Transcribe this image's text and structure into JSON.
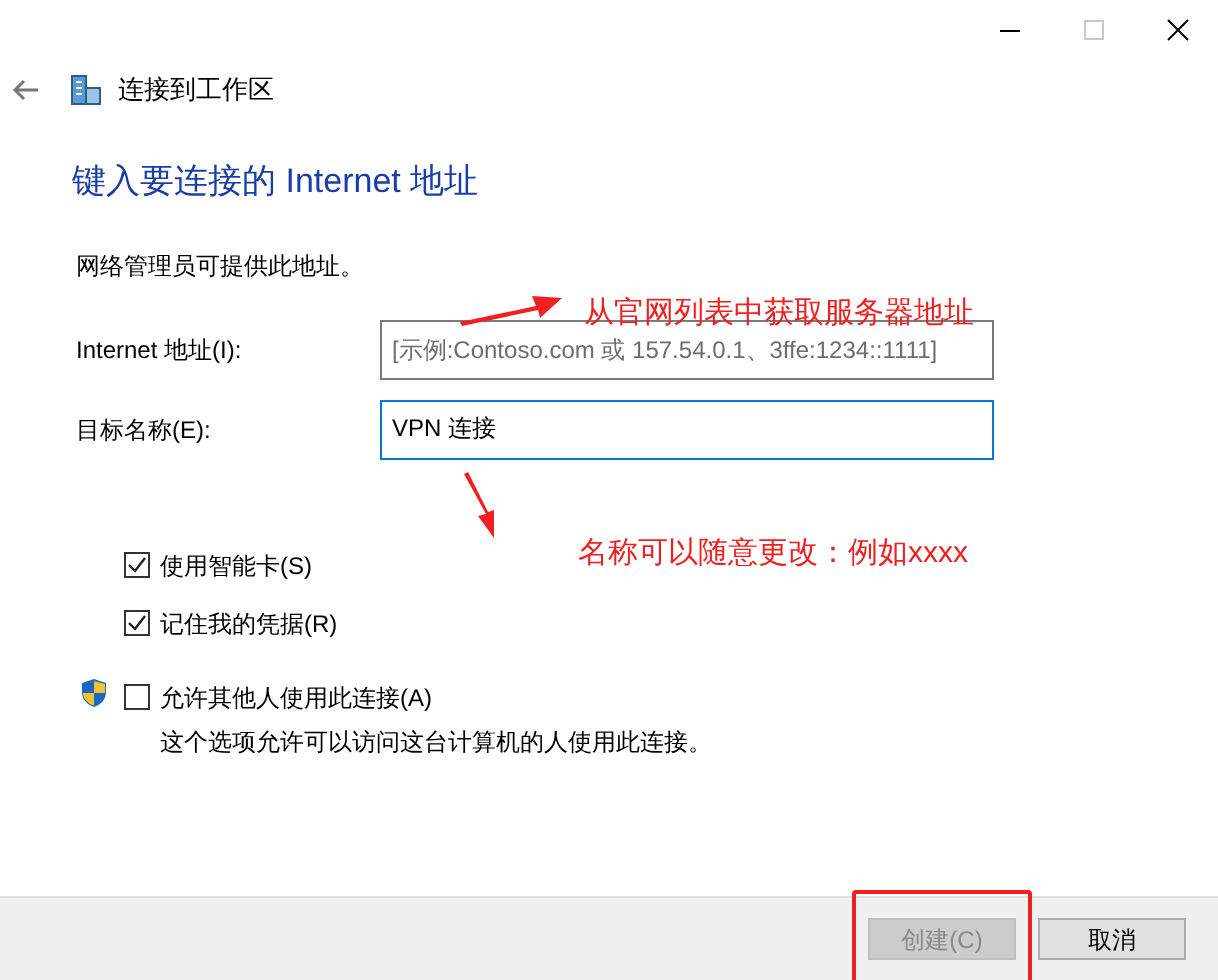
{
  "window": {
    "title": "连接到工作区"
  },
  "heading": "键入要连接的 Internet 地址",
  "intro": "网络管理员可提供此地址。",
  "fields": [
    {
      "label": "Internet 地址(I):",
      "placeholder": "[示例:Contoso.com 或 157.54.0.1、3ffe:1234::1111]",
      "focused": false
    },
    {
      "label": "目标名称(E):",
      "value": "VPN 连接",
      "focused": true
    }
  ],
  "options": [
    {
      "label": "使用智能卡(S)",
      "checked": true,
      "shield": false
    },
    {
      "label": "记住我的凭据(R)",
      "checked": true,
      "shield": false
    },
    {
      "label": "允许其他人使用此连接(A)",
      "checked": false,
      "shield": true,
      "description": "这个选项允许可以访问这台计算机的人使用此连接。"
    }
  ],
  "buttons": [
    {
      "label": "创建(C)",
      "disabled": true,
      "highlighted": true
    },
    {
      "label": "取消",
      "disabled": false,
      "highlighted": false
    }
  ],
  "annotations": [
    "从官网列表中获取服务器地址",
    "名称可以随意更改：例如xxxx"
  ]
}
